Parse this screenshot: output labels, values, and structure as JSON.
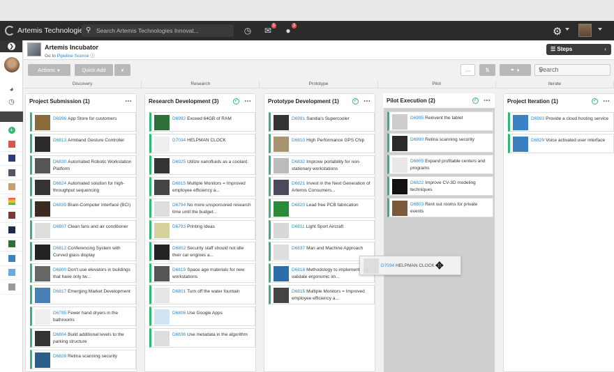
{
  "app": {
    "brand": "Artemis Technologies",
    "search_placeholder": "Search Artemis Technologies Innovat...",
    "messages_count": "5",
    "notifications_count": "3"
  },
  "header": {
    "title": "Artemis Incubator",
    "goto_prefix": "Go to",
    "goto_link": "Pipeline Source",
    "steps_label": "Steps"
  },
  "toolbar": {
    "actions_label": "Actions",
    "quick_add_label": "Quick Add",
    "search_placeholder": "Search"
  },
  "stages": [
    "Discovery",
    "Research",
    "Prototype",
    "Pilot",
    "Iterate"
  ],
  "columns": [
    {
      "title": "Project Submission",
      "count": "(1)",
      "cards": [
        {
          "id": "D6996",
          "text": "App Store for customers",
          "icon": "app-store-thumb",
          "color": "#8a6a3a"
        },
        {
          "id": "D6813",
          "text": "Armband Gesture Controller",
          "icon": "armband-thumb",
          "color": "#2b2b2b"
        },
        {
          "id": "D6830",
          "text": "Automated Robotic Workstation Platform",
          "icon": "robot-thumb",
          "color": "#555"
        },
        {
          "id": "D6824",
          "text": "Automated solution for high-throughput sequencing",
          "icon": "dna-thumb",
          "color": "#333"
        },
        {
          "id": "D6835",
          "text": "Brain-Computer Interface (BCI)",
          "icon": "brain-thumb",
          "color": "#3a2a20"
        },
        {
          "id": "D6807",
          "text": "Clean fans and air conditioner",
          "icon": "fan-thumb",
          "color": "#ddd"
        },
        {
          "id": "D6812",
          "text": "Conferencing System with Curved glass display",
          "icon": "display-thumb",
          "color": "#222"
        },
        {
          "id": "D6800",
          "text": "Don't use elevators in buildings that have only tw...",
          "icon": "stairs-thumb",
          "color": "#666"
        },
        {
          "id": "D6817",
          "text": "Emerging Market Development",
          "icon": "market-thumb",
          "color": "#4a7fb5"
        },
        {
          "id": "D6795",
          "text": "Fewer hand dryers in the bathrooms",
          "icon": "dryer-thumb",
          "color": "#eee"
        },
        {
          "id": "D6804",
          "text": "Build additional levels to the parking structure",
          "icon": "parking-thumb",
          "color": "#333"
        },
        {
          "id": "D6828",
          "text": "Retina scanning security",
          "icon": "retina-thumb",
          "color": "#2c5e8a"
        }
      ]
    },
    {
      "title": "Research Development",
      "count": "(3)",
      "cards": [
        {
          "id": "D6992",
          "text": "Exceed 64GB of RAM",
          "icon": "ram-thumb",
          "color": "#2f6f3a"
        },
        {
          "id": "D7034",
          "text": "HELPMAN CLOCK",
          "icon": "clock-thumb",
          "color": "#eee"
        },
        {
          "id": "D6925",
          "text": "Utilize nanofluids as a coolant.",
          "icon": "chip-thumb",
          "color": "#333"
        },
        {
          "id": "D6815",
          "text": "Multiple Monitors = Improved employee efficiency a...",
          "icon": "monitors-thumb",
          "color": "#444"
        },
        {
          "id": "D6794",
          "text": "No more unsponsored research time until the budget...",
          "icon": "bulb-thumb",
          "color": "#ddd"
        },
        {
          "id": "D6793",
          "text": "Printing Ideas",
          "icon": "printing-thumb",
          "color": "#d6d2a0"
        },
        {
          "id": "D6802",
          "text": "Security staff should not idle their car engines a...",
          "icon": "car-thumb",
          "color": "#222"
        },
        {
          "id": "D6819",
          "text": "Space age materials for new workstations",
          "icon": "materials-thumb",
          "color": "#555"
        },
        {
          "id": "D6801",
          "text": "Turn off the water fountain",
          "icon": "fountain-thumb",
          "color": "#e6e6e6"
        },
        {
          "id": "D6806",
          "text": "Use Google Apps",
          "icon": "google-thumb",
          "color": "#d0e4f4"
        },
        {
          "id": "D6836",
          "text": "Use metadata in the algorithm",
          "icon": "bulb-thumb",
          "color": "#ddd"
        }
      ]
    },
    {
      "title": "Prototype Development",
      "count": "(1)",
      "cards": [
        {
          "id": "D6991",
          "text": "Sandia's Supercooler",
          "icon": "cooler-thumb",
          "color": "#333"
        },
        {
          "id": "D6810",
          "text": "High Performance GPS Chip",
          "icon": "gps-chip-thumb",
          "color": "#a89570"
        },
        {
          "id": "D6832",
          "text": "Improve portability for non-stationary workstations",
          "icon": "portable-thumb",
          "color": "#bbb"
        },
        {
          "id": "D6821",
          "text": "Invest in the Next Generation of Artemis Consumers...",
          "icon": "invest-thumb",
          "color": "#4a4a5a"
        },
        {
          "id": "D6820",
          "text": "Lead free PCB fabrication",
          "icon": "pb-free-thumb",
          "color": "#2a8a3a"
        },
        {
          "id": "D6811",
          "text": "Light Sport Aircraft",
          "icon": "aircraft-thumb",
          "color": "#d8d8d8"
        },
        {
          "id": "D6837",
          "text": "Man and Machine Approach",
          "icon": "bulb-thumb",
          "color": "#ddd"
        },
        {
          "id": "D6818",
          "text": "Methodology to implement and validate ergonomic im...",
          "icon": "ergonomic-thumb",
          "color": "#2b6ea8"
        },
        {
          "id": "D6815",
          "text": "Multiple Monitors = Improved employee efficiency a...",
          "icon": "monitors-thumb",
          "color": "#444"
        }
      ]
    },
    {
      "title": "Pilot Execution",
      "count": "(2)",
      "cards": [
        {
          "id": "D6995",
          "text": "Reinvent the tablet",
          "icon": "tablet-thumb",
          "color": "#ccc"
        },
        {
          "id": "D6990",
          "text": "Retina scanning security",
          "icon": "retina-thumb",
          "color": "#2a2a2a"
        },
        {
          "id": "D6805",
          "text": "Expand profitable centers and programs",
          "icon": "chart-thumb",
          "color": "#e8e8e8"
        },
        {
          "id": "D6822",
          "text": "Improve CV-3D modeling techniques",
          "icon": "modeling-thumb",
          "color": "#111"
        },
        {
          "id": "D6803",
          "text": "Rent out rooms for private events",
          "icon": "room-thumb",
          "color": "#7a5a3a"
        }
      ]
    },
    {
      "title": "Project Iteration",
      "count": "(1)",
      "cards": [
        {
          "id": "D6993",
          "text": "Provide a cloud hosting service",
          "icon": "cloud-thumb",
          "color": "#3b82c4"
        },
        {
          "id": "D6829",
          "text": "Voice activated user interface",
          "icon": "voice-thumb",
          "color": "#3b7fc0"
        }
      ]
    }
  ],
  "drag_card": {
    "id": "D7034",
    "text": "HELPMAN CLOCK"
  },
  "colors": {
    "accent": "#2eb872",
    "link": "#2a88c8",
    "topbar": "#2b2b2b",
    "fab_blue": "#2a8fd8",
    "fab_green": "#2eb872"
  }
}
